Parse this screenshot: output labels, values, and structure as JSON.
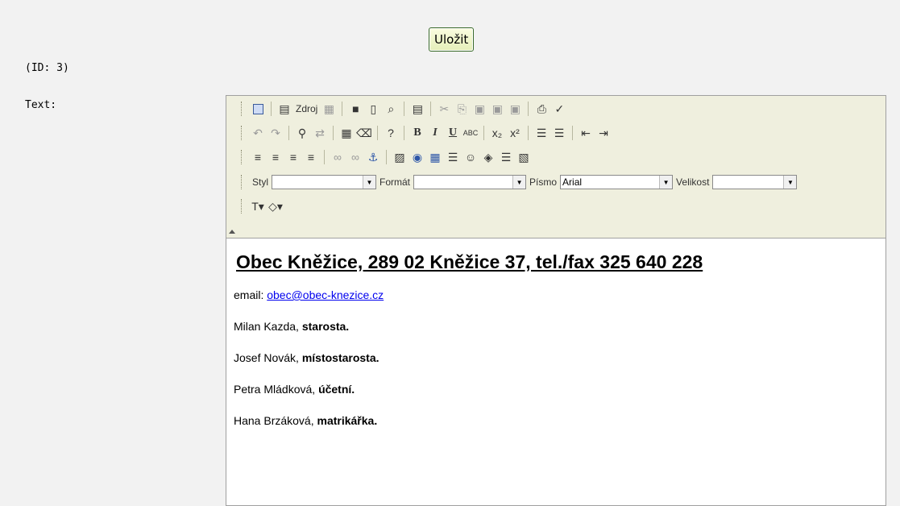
{
  "form": {
    "save_label": "Uložit",
    "id_label": "(ID: 3)",
    "text_label": "Text:"
  },
  "toolbar": {
    "source_label": "Zdroj",
    "abc_label": "ABC",
    "style_label": "Styl",
    "style_value": "",
    "format_label": "Formát",
    "format_value": "",
    "font_label": "Písmo",
    "font_value": "Arial",
    "size_label": "Velikost",
    "size_value": ""
  },
  "content": {
    "heading": "Obec Kněžice, 289 02 Kněžice 37, tel./fax 325 640 228",
    "email_prefix": "email: ",
    "email": "obec@obec-knezice.cz",
    "people": [
      {
        "name": "Milan Kazda, ",
        "role": "starosta."
      },
      {
        "name": "Josef Novák, ",
        "role": "místostarosta."
      },
      {
        "name": "Petra Mládková, ",
        "role": "účetní."
      },
      {
        "name": "Hana Brzáková, ",
        "role": "matrikářka."
      }
    ]
  }
}
